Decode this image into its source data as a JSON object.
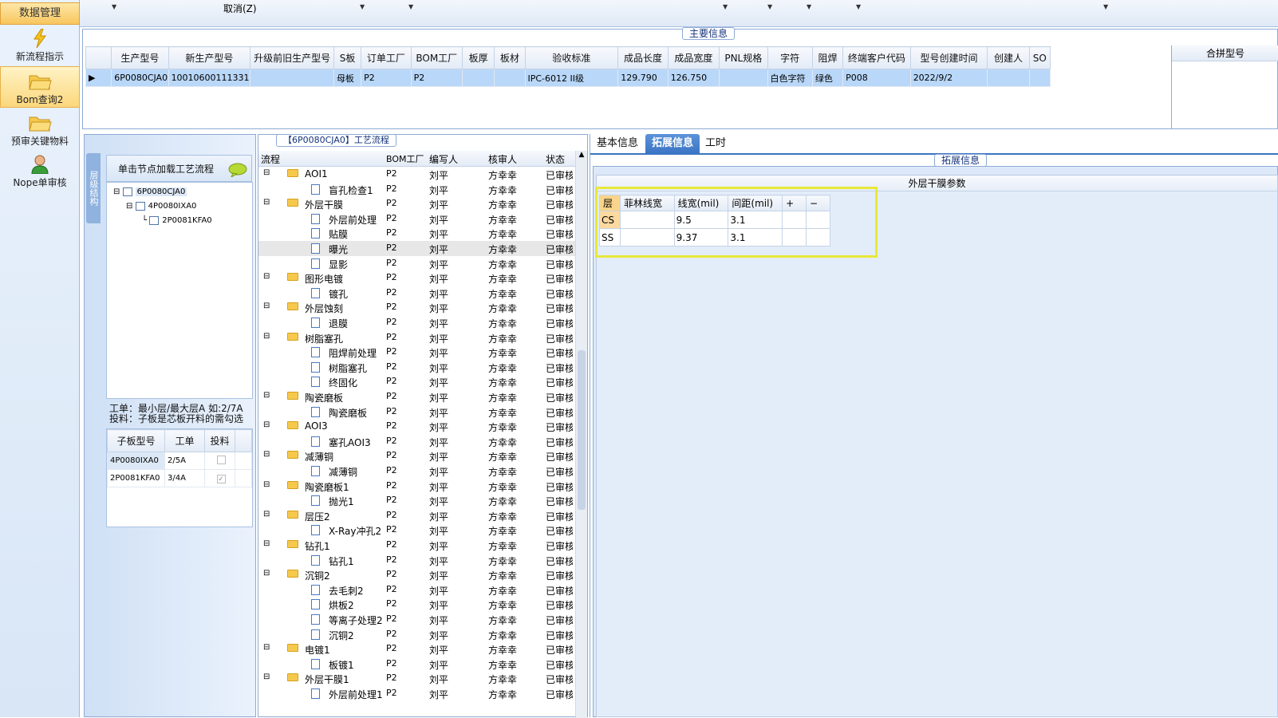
{
  "nav": {
    "header": "数据管理",
    "items": [
      {
        "label": "新流程指示",
        "icon": "lightning-icon"
      },
      {
        "label": "Bom查询2",
        "icon": "folder-open-icon",
        "active": true
      },
      {
        "label": "预审关键物料",
        "icon": "folder-open-icon"
      },
      {
        "label": "Nope单审核",
        "icon": "user-icon"
      }
    ]
  },
  "toolbar": {
    "cancel_label": "取消(Z)"
  },
  "main_info": {
    "title": "主要信息",
    "columns": [
      "生产型号",
      "新生产型号",
      "升级前旧生产型号",
      "S板",
      "订单工厂",
      "BOM工厂",
      "板厚",
      "板材",
      "验收标准",
      "成品长度",
      "成品宽度",
      "PNL规格",
      "字符",
      "阻焊",
      "终端客户代码",
      "型号创建时间",
      "创建人",
      "SO"
    ],
    "row": [
      "6P0080CJA0",
      "10010600111331",
      "",
      "母板",
      "P2",
      "P2",
      "",
      "",
      "IPC-6012 II级",
      "129.790",
      "126.750",
      "",
      "白色字符",
      "绿色",
      "P008",
      "2022/9/2",
      "",
      ""
    ],
    "merge_header": "合拼型号"
  },
  "structure": {
    "vtab_label": "层级结构",
    "hint": "单击节点加载工艺流程",
    "tree": [
      "6P0080CJA0",
      "4P0080IXA0",
      "2P0081KFA0"
    ],
    "note_line1": "工单：最小层/最大层A 如:2/7A",
    "note_line2": "投料：子板是芯板开料的需勾选",
    "sub_columns": [
      "子板型号",
      "工单",
      "投料"
    ],
    "sub_rows": [
      {
        "model": "4P0080IXA0",
        "order": "2/5A",
        "checked": false
      },
      {
        "model": "2P0081KFA0",
        "order": "3/4A",
        "checked": true
      }
    ]
  },
  "process": {
    "title": "【6P0080CJA0】工艺流程",
    "columns": [
      "流程",
      "BOM工厂",
      "编写人",
      "核审人",
      "状态"
    ],
    "rows": [
      {
        "name": "AOI1",
        "type": "folder"
      },
      {
        "name": "盲孔检查1",
        "type": "doc"
      },
      {
        "name": "外层干膜",
        "type": "folder"
      },
      {
        "name": "外层前处理",
        "type": "doc"
      },
      {
        "name": "贴膜",
        "type": "doc"
      },
      {
        "name": "曝光",
        "type": "doc",
        "selected": true
      },
      {
        "name": "显影",
        "type": "doc"
      },
      {
        "name": "图形电镀",
        "type": "folder"
      },
      {
        "name": "镀孔",
        "type": "doc"
      },
      {
        "name": "外层蚀刻",
        "type": "folder"
      },
      {
        "name": "退膜",
        "type": "doc"
      },
      {
        "name": "树脂塞孔",
        "type": "folder"
      },
      {
        "name": "阻焊前处理",
        "type": "doc"
      },
      {
        "name": "树脂塞孔",
        "type": "doc"
      },
      {
        "name": "终固化",
        "type": "doc"
      },
      {
        "name": "陶瓷磨板",
        "type": "folder"
      },
      {
        "name": "陶瓷磨板",
        "type": "doc"
      },
      {
        "name": "AOI3",
        "type": "folder"
      },
      {
        "name": "塞孔AOI3",
        "type": "doc"
      },
      {
        "name": "减薄铜",
        "type": "folder"
      },
      {
        "name": "减薄铜",
        "type": "doc"
      },
      {
        "name": "陶瓷磨板1",
        "type": "folder"
      },
      {
        "name": "抛光1",
        "type": "doc"
      },
      {
        "name": "层压2",
        "type": "folder"
      },
      {
        "name": "X-Ray冲孔2",
        "type": "doc"
      },
      {
        "name": "钻孔1",
        "type": "folder"
      },
      {
        "name": "钻孔1",
        "type": "doc"
      },
      {
        "name": "沉铜2",
        "type": "folder"
      },
      {
        "name": "去毛刺2",
        "type": "doc"
      },
      {
        "name": "烘板2",
        "type": "doc"
      },
      {
        "name": "等离子处理2",
        "type": "doc"
      },
      {
        "name": "沉铜2",
        "type": "doc"
      },
      {
        "name": "电镀1",
        "type": "folder"
      },
      {
        "name": "板镀1",
        "type": "doc"
      },
      {
        "name": "外层干膜1",
        "type": "folder"
      },
      {
        "name": "外层前处理1",
        "type": "doc"
      }
    ],
    "bom": "P2",
    "writer": "刘平",
    "reviewer": "方幸幸",
    "status": "已审核"
  },
  "right": {
    "tabs": [
      "基本信息",
      "拓展信息",
      "工时"
    ],
    "active_tab": "拓展信息",
    "ext_title": "拓展信息",
    "section_title": "外层干膜参数",
    "grid_columns": [
      "层",
      "菲林线宽",
      "线宽(mil)",
      "间距(mil)",
      "+",
      "−"
    ],
    "grid_rows": [
      [
        "CS",
        "",
        "9.5",
        "3.1",
        "",
        ""
      ],
      [
        "SS",
        "",
        "9.37",
        "3.1",
        "",
        ""
      ]
    ]
  }
}
